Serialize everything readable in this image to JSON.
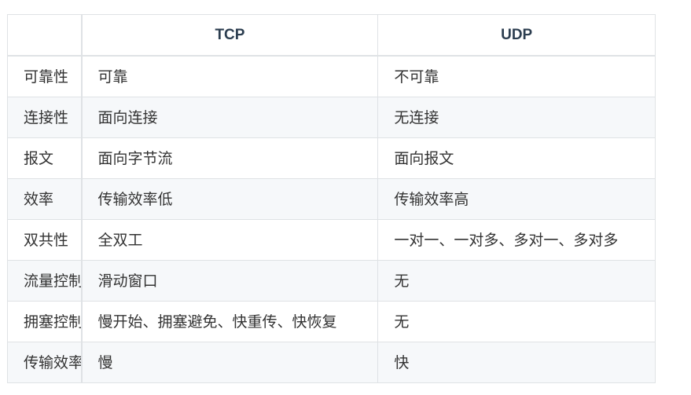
{
  "table": {
    "headers": [
      "",
      "TCP",
      "UDP"
    ],
    "rows": [
      {
        "label": "可靠性",
        "tcp": "可靠",
        "udp": "不可靠"
      },
      {
        "label": "连接性",
        "tcp": "面向连接",
        "udp": "无连接"
      },
      {
        "label": "报文",
        "tcp": "面向字节流",
        "udp": "面向报文"
      },
      {
        "label": "效率",
        "tcp": "传输效率低",
        "udp": "传输效率高"
      },
      {
        "label": "双共性",
        "tcp": "全双工",
        "udp": "一对一、一对多、多对一、多对多"
      },
      {
        "label": "流量控制",
        "tcp": "滑动窗口",
        "udp": "无"
      },
      {
        "label": "拥塞控制",
        "tcp": "慢开始、拥塞避免、快重传、快恢复",
        "udp": "无"
      },
      {
        "label": "传输效率",
        "tcp": "慢",
        "udp": "快"
      }
    ]
  }
}
